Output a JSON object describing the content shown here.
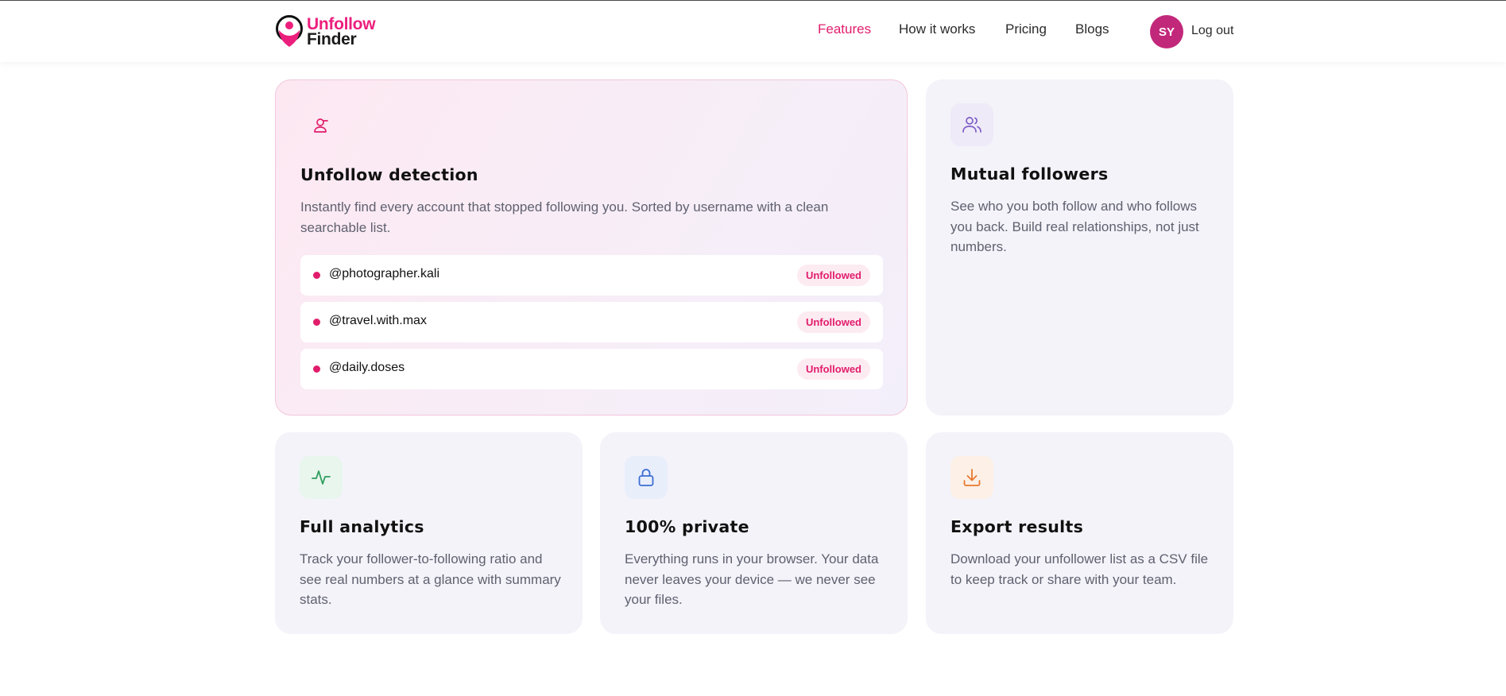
{
  "brand": {
    "line1": "Unfollow",
    "line2": "Finder"
  },
  "nav": {
    "features": "Features",
    "how": "How it works",
    "pricing": "Pricing",
    "blogs": "Blogs"
  },
  "user": {
    "initials": "SY",
    "logout": "Log out"
  },
  "cards": {
    "unfollow": {
      "icon": "user-minus-icon",
      "title": "Unfollow detection",
      "desc": "Instantly find every account that stopped following you. Sorted by username with a clean searchable list.",
      "rows": [
        {
          "handle": "@photographer.kali",
          "tag": "Unfollowed"
        },
        {
          "handle": "@travel.with.max",
          "tag": "Unfollowed"
        },
        {
          "handle": "@daily.doses",
          "tag": "Unfollowed"
        }
      ]
    },
    "mutual": {
      "icon": "users-icon",
      "title": "Mutual followers",
      "desc": "See who you both follow and who follows you back. Build real relationships, not just numbers."
    },
    "analytics": {
      "icon": "activity-icon",
      "title": "Full analytics",
      "desc": "Track your follower-to-following ratio and see real numbers at a glance with summary stats."
    },
    "private": {
      "icon": "lock-icon",
      "title": "100% private",
      "desc": "Everything runs in your browser. Your data never leaves your device — we never see your files."
    },
    "export": {
      "icon": "download-icon",
      "title": "Export results",
      "desc": "Download your unfollower list as a CSV file to keep track or share with your team."
    }
  },
  "colors": {
    "accent": "#e11d6b",
    "avatar": "#c2287a",
    "card_bg": "#f4f3f9"
  }
}
